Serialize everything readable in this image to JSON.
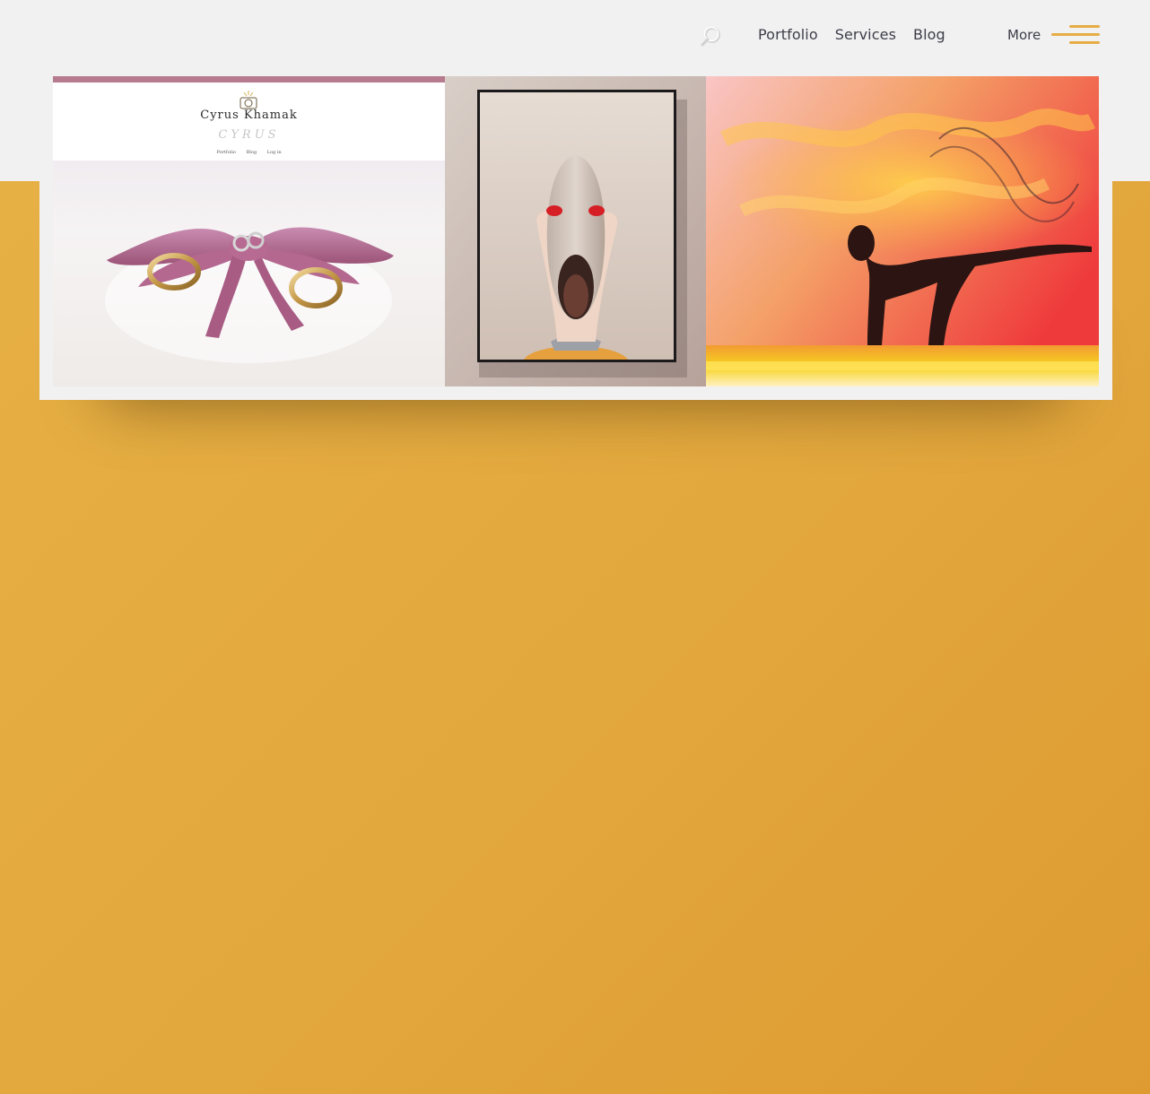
{
  "header": {
    "search_icon": "search-icon",
    "nav": [
      {
        "label": "Portfolio"
      },
      {
        "label": "Services"
      },
      {
        "label": "Blog"
      }
    ],
    "more_label": "More",
    "menu_icon": "hamburger-menu-icon"
  },
  "gallery": {
    "items": [
      {
        "name": "wedding-rings",
        "site_title": "Cyrus Khamak",
        "site_script": "CYRUS",
        "site_nav": [
          "Portfolio",
          "Blog",
          "Log in"
        ]
      },
      {
        "name": "shoe-face-frame"
      },
      {
        "name": "yoga-sunset"
      }
    ]
  },
  "colors": {
    "accent": "#e6ad45",
    "background_gold": "#e2a73d",
    "top_band": "#f1f1f1",
    "nav_text": "#3d3d4a",
    "mini_site_bar": "#b77b8f"
  }
}
